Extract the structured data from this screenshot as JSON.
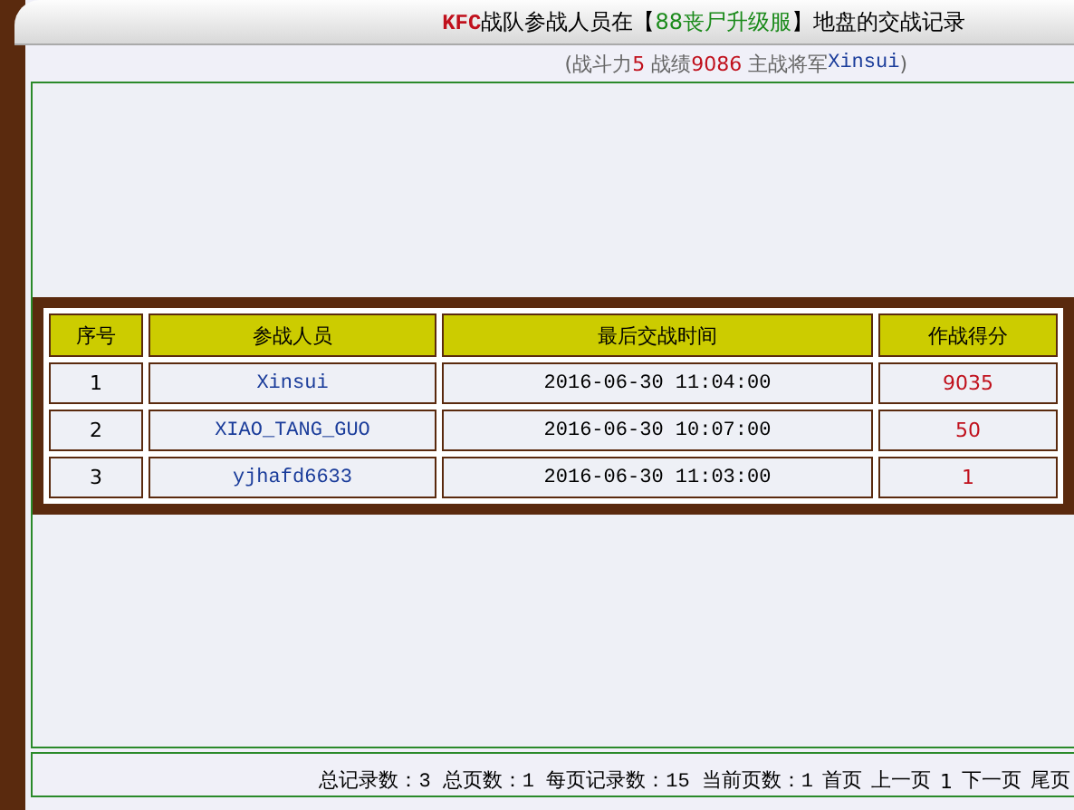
{
  "title": {
    "team": "KFC",
    "before": "战队参战人员在【",
    "server": "88丧尸升级服",
    "after": "】地盘的交战记录"
  },
  "subtitle": {
    "open": "(战斗力",
    "power": "5",
    "record_label": " 战绩",
    "record": "9086",
    "general_label": " 主战将军",
    "general": "Xinsui",
    "close": ")"
  },
  "table": {
    "columns": [
      "序号",
      "参战人员",
      "最后交战时间",
      "作战得分"
    ],
    "rows": [
      {
        "index": "1",
        "player": "Xinsui",
        "time": "2016-06-30 11:04:00",
        "score": "9035"
      },
      {
        "index": "2",
        "player": "XIAO_TANG_GUO",
        "time": "2016-06-30 10:07:00",
        "score": "50"
      },
      {
        "index": "3",
        "player": "yjhafd6633",
        "time": "2016-06-30 11:03:00",
        "score": "1"
      }
    ]
  },
  "pager": {
    "stats": "总记录数：3 总页数：1 每页记录数：15 当前页数：1",
    "links": [
      "首页",
      "上一页",
      "1",
      "下一页",
      "尾页"
    ]
  }
}
